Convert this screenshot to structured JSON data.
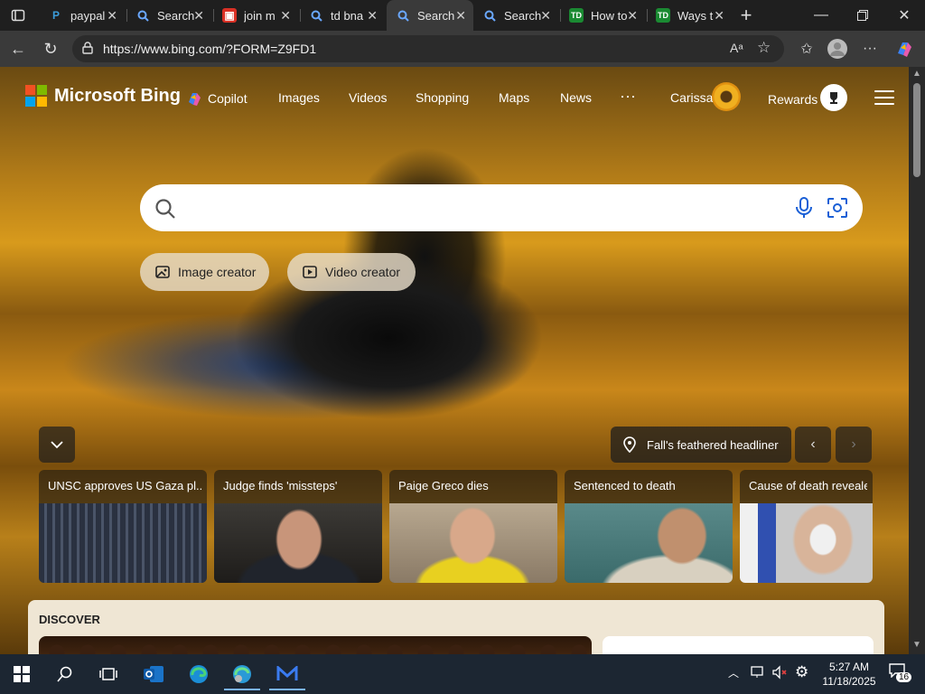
{
  "browser": {
    "tabs": [
      {
        "label": "paypal",
        "favicon": "paypal-icon",
        "color": "#0070ba",
        "active": false
      },
      {
        "label": "Search",
        "favicon": "bing-search-icon",
        "color": "#3b82f6",
        "active": false
      },
      {
        "label": "join m",
        "favicon": "red-app-icon",
        "color": "#d93025",
        "active": false
      },
      {
        "label": "td bna",
        "favicon": "bing-search-icon",
        "color": "#3b82f6",
        "active": false
      },
      {
        "label": "Search",
        "favicon": "bing-search-icon",
        "color": "#3b82f6",
        "active": true
      },
      {
        "label": "Search",
        "favicon": "bing-search-icon",
        "color": "#3b82f6",
        "active": false
      },
      {
        "label": "How to",
        "favicon": "td-icon",
        "color": "#1a8a32",
        "active": false
      },
      {
        "label": "Ways t",
        "favicon": "td-icon",
        "color": "#1a8a32",
        "active": false
      }
    ],
    "url": "https://www.bing.com/?FORM=Z9FD1"
  },
  "bing": {
    "logo_text": "Microsoft Bing",
    "nav": {
      "copilot": "Copilot",
      "images": "Images",
      "videos": "Videos",
      "shopping": "Shopping",
      "maps": "Maps",
      "news": "News",
      "more": "···"
    },
    "user_name": "Carissa",
    "rewards": "Rewards",
    "search_placeholder": "",
    "image_creator": "Image creator",
    "video_creator": "Video creator",
    "headline": "Fall's feathered headliner",
    "news_cards": [
      {
        "title": "UNSC approves US Gaza pl..."
      },
      {
        "title": "Judge finds 'missteps'"
      },
      {
        "title": "Paige Greco dies"
      },
      {
        "title": "Sentenced to death"
      },
      {
        "title": "Cause of death revealed"
      }
    ],
    "discover": "DISCOVER"
  },
  "taskbar": {
    "time": "5:27 AM",
    "date": "11/18/2025",
    "notifications": "16"
  }
}
